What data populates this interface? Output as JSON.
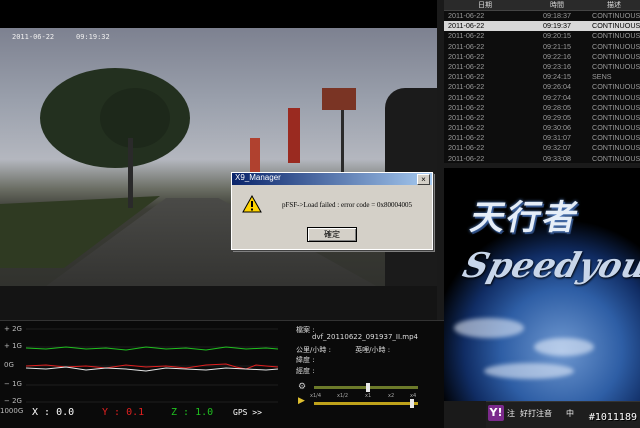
{
  "video": {
    "osd_date": "2011-06-22",
    "osd_time": "09:19:32"
  },
  "dialog": {
    "title": "X9_Manager",
    "message": "pFSF->Load failed : error code = 0x80004005",
    "ok_label": "確定",
    "close_label": "×"
  },
  "list": {
    "headers": [
      "日期",
      "時間",
      "描述"
    ],
    "rows": [
      {
        "date": "2011-06-22",
        "time": "09:18:37",
        "desc": "CONTINUOUS"
      },
      {
        "date": "2011-06-22",
        "time": "09:19:37",
        "desc": "CONTINUOUS"
      },
      {
        "date": "2011-06-22",
        "time": "09:20:15",
        "desc": "CONTINUOUS"
      },
      {
        "date": "2011-06-22",
        "time": "09:21:15",
        "desc": "CONTINUOUS"
      },
      {
        "date": "2011-06-22",
        "time": "09:22:16",
        "desc": "CONTINUOUS"
      },
      {
        "date": "2011-06-22",
        "time": "09:23:16",
        "desc": "CONTINUOUS"
      },
      {
        "date": "2011-06-22",
        "time": "09:24:15",
        "desc": "SENS"
      },
      {
        "date": "2011-06-22",
        "time": "09:26:04",
        "desc": "CONTINUOUS"
      },
      {
        "date": "2011-06-22",
        "time": "09:27:04",
        "desc": "CONTINUOUS"
      },
      {
        "date": "2011-06-22",
        "time": "09:28:05",
        "desc": "CONTINUOUS"
      },
      {
        "date": "2011-06-22",
        "time": "09:29:05",
        "desc": "CONTINUOUS"
      },
      {
        "date": "2011-06-22",
        "time": "09:30:06",
        "desc": "CONTINUOUS"
      },
      {
        "date": "2011-06-22",
        "time": "09:31:07",
        "desc": "CONTINUOUS"
      },
      {
        "date": "2011-06-22",
        "time": "09:32:07",
        "desc": "CONTINUOUS"
      },
      {
        "date": "2011-06-22",
        "time": "09:33:08",
        "desc": "CONTINUOUS"
      }
    ],
    "selected_index": 1
  },
  "branding": {
    "logo_text": "天行者",
    "speed_text": "Speedyou"
  },
  "gsensor": {
    "labels": [
      "+ 2G",
      "+ 1G",
      "0G",
      "− 1G",
      "− 2G"
    ],
    "scale_label": "1000G"
  },
  "axes": {
    "x_label": "X : 0.0",
    "y_label": "Y : 0.1",
    "z_label": "Z : 1.0",
    "gps_label": "GPS >>",
    "x_color": "#ffffff",
    "y_color": "#e02020",
    "z_color": "#20c020"
  },
  "info": {
    "file_label": "檔案 :",
    "file_name": "dvf_20110622_091937_II.mp4",
    "coord_label": "公里/小時 :",
    "coord2_label": "英哩/小時 :",
    "lat_label": "緯度 :",
    "lon_label": "經度 :",
    "speed_ticks": [
      "x1/4",
      "x1/2",
      "x1",
      "x2",
      "x4"
    ]
  },
  "tray": {
    "yahoo": "Y!",
    "note": "注",
    "input_label": "好打注音",
    "lang": "中",
    "watermark": "#1011189"
  }
}
